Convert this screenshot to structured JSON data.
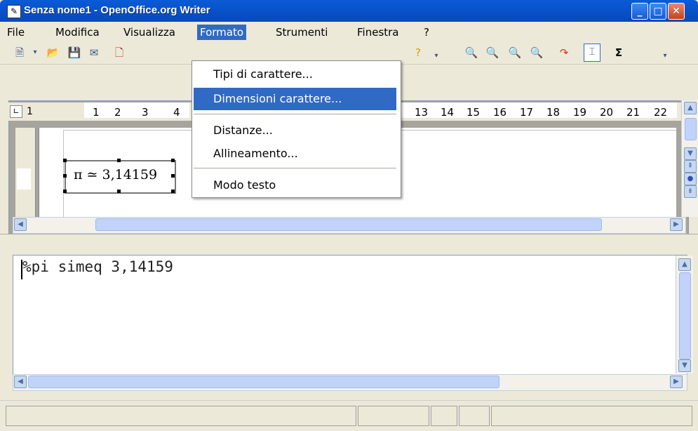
{
  "window": {
    "title": "Senza nome1 - OpenOffice.org Writer"
  },
  "menubar": {
    "items": [
      {
        "label": "File"
      },
      {
        "label": "Modifica"
      },
      {
        "label": "Visualizza"
      },
      {
        "label": "Formato"
      },
      {
        "label": "Strumenti"
      },
      {
        "label": "Finestra"
      },
      {
        "label": "?"
      }
    ]
  },
  "format_menu": {
    "items": [
      {
        "label": "Tipi di carattere..."
      },
      {
        "label": "Dimensioni carattere..."
      },
      {
        "label": "Distanze..."
      },
      {
        "label": "Allineamento..."
      },
      {
        "label": "Modo testo"
      }
    ]
  },
  "ruler": {
    "left_marker": "1",
    "ticks": [
      "1",
      "2",
      "3",
      "4",
      "13",
      "14",
      "15",
      "16",
      "17",
      "18",
      "19",
      "20",
      "21",
      "22"
    ]
  },
  "document": {
    "formula_display": "π ≃ 3,14159"
  },
  "command": {
    "text": "%pi simeq 3,14159"
  },
  "toolbar": {
    "sum_label": "Σ"
  }
}
